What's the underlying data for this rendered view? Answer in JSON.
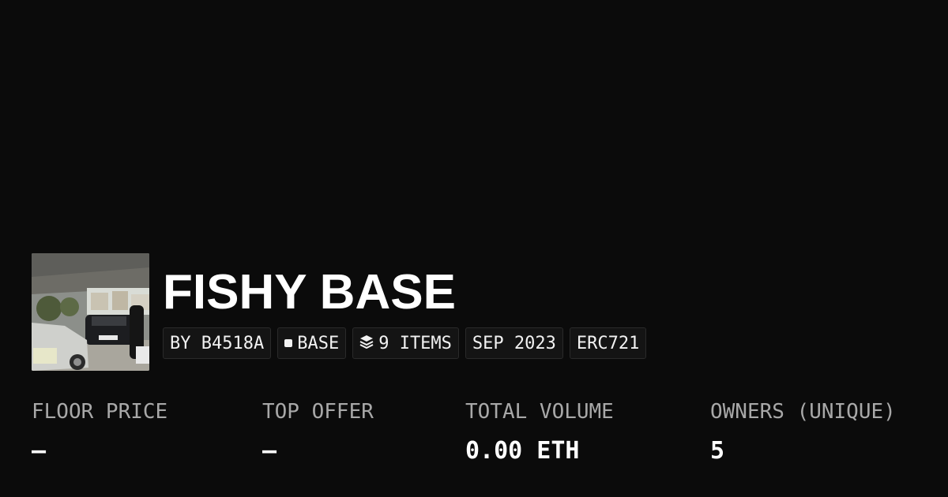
{
  "collection": {
    "title": "FISHY BASE",
    "thumbnail_alt": "collection thumbnail photo"
  },
  "chips": {
    "creator": "BY B4518A",
    "chain": "BASE",
    "items": "9 ITEMS",
    "date": "SEP 2023",
    "standard": "ERC721"
  },
  "stats": {
    "floor_price": {
      "label": "FLOOR PRICE",
      "value": "—"
    },
    "top_offer": {
      "label": "TOP OFFER",
      "value": "—"
    },
    "total_volume": {
      "label": "TOTAL VOLUME",
      "value": "0.00 ETH"
    },
    "owners": {
      "label": "OWNERS (UNIQUE)",
      "value": "5"
    }
  },
  "colors": {
    "background": "#0b0b0b",
    "chip_background": "#141414",
    "chip_border": "#2a2a2a",
    "text_primary": "#ffffff",
    "text_muted": "#a8a8a8"
  },
  "icons": {
    "chain": "square-icon",
    "items": "layers-icon"
  }
}
